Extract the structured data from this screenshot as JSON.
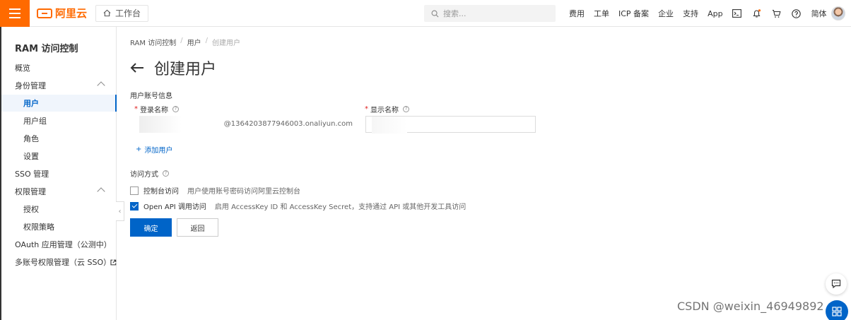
{
  "topbar": {
    "workbench": "工作台",
    "search_placeholder": "搜索...",
    "nav": [
      "费用",
      "工单",
      "ICP 备案",
      "企业",
      "支持",
      "App"
    ],
    "lang": "简体",
    "brand": "阿里云",
    "accent": "#ff6a00"
  },
  "sidebar": {
    "title": "RAM 访问控制",
    "items": [
      {
        "label": "概览"
      },
      {
        "label": "身份管理"
      },
      {
        "label": "用户"
      },
      {
        "label": "用户组"
      },
      {
        "label": "角色"
      },
      {
        "label": "设置"
      },
      {
        "label": "SSO 管理"
      },
      {
        "label": "权限管理"
      },
      {
        "label": "授权"
      },
      {
        "label": "权限策略"
      },
      {
        "label": "OAuth 应用管理（公测中）"
      },
      {
        "label": "多账号权限管理（云 SSO）"
      }
    ]
  },
  "breadcrumb": [
    "RAM 访问控制",
    "用户",
    "创建用户"
  ],
  "page_title": "创建用户",
  "form": {
    "section_account": "用户账号信息",
    "login_label": "登录名称",
    "display_label": "显示名称",
    "login_suffix": "@1364203877946003.onaliyun.com",
    "add_user": "添加用户",
    "section_access": "访问方式",
    "console_label": "控制台访问",
    "console_desc": "用户使用账号密码访问阿里云控制台",
    "api_label": "Open API 调用访问",
    "api_desc": "启用 AccessKey ID 和 AccessKey Secret，支持通过 API 或其他开发工具访问",
    "ok": "确定",
    "back": "返回"
  },
  "watermark": "CSDN @weixin_46949892",
  "primary_color": "#0064c8"
}
